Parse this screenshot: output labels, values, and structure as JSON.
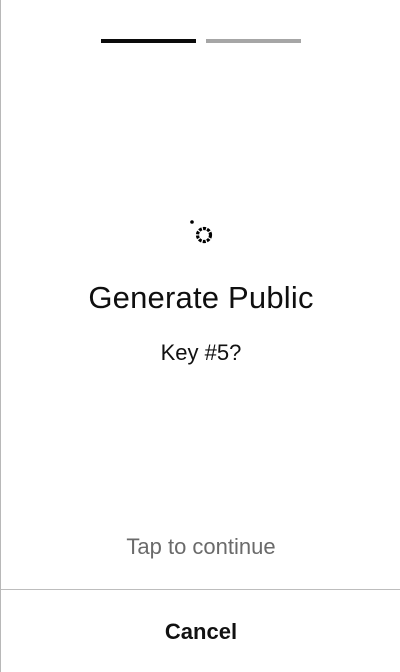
{
  "onboarding": {
    "progress": {
      "total_steps": 2,
      "current_step": 1
    },
    "icon": "key-icon",
    "title": "Generate Public",
    "subtitle": "Key #5?",
    "hint": "Tap to continue",
    "cancel_label": "Cancel"
  },
  "colors": {
    "progress_active": "#0b0b0b",
    "progress_inactive": "#a6a6a6",
    "hint_text": "#6a6a6a",
    "divider": "#bdbdbd"
  }
}
